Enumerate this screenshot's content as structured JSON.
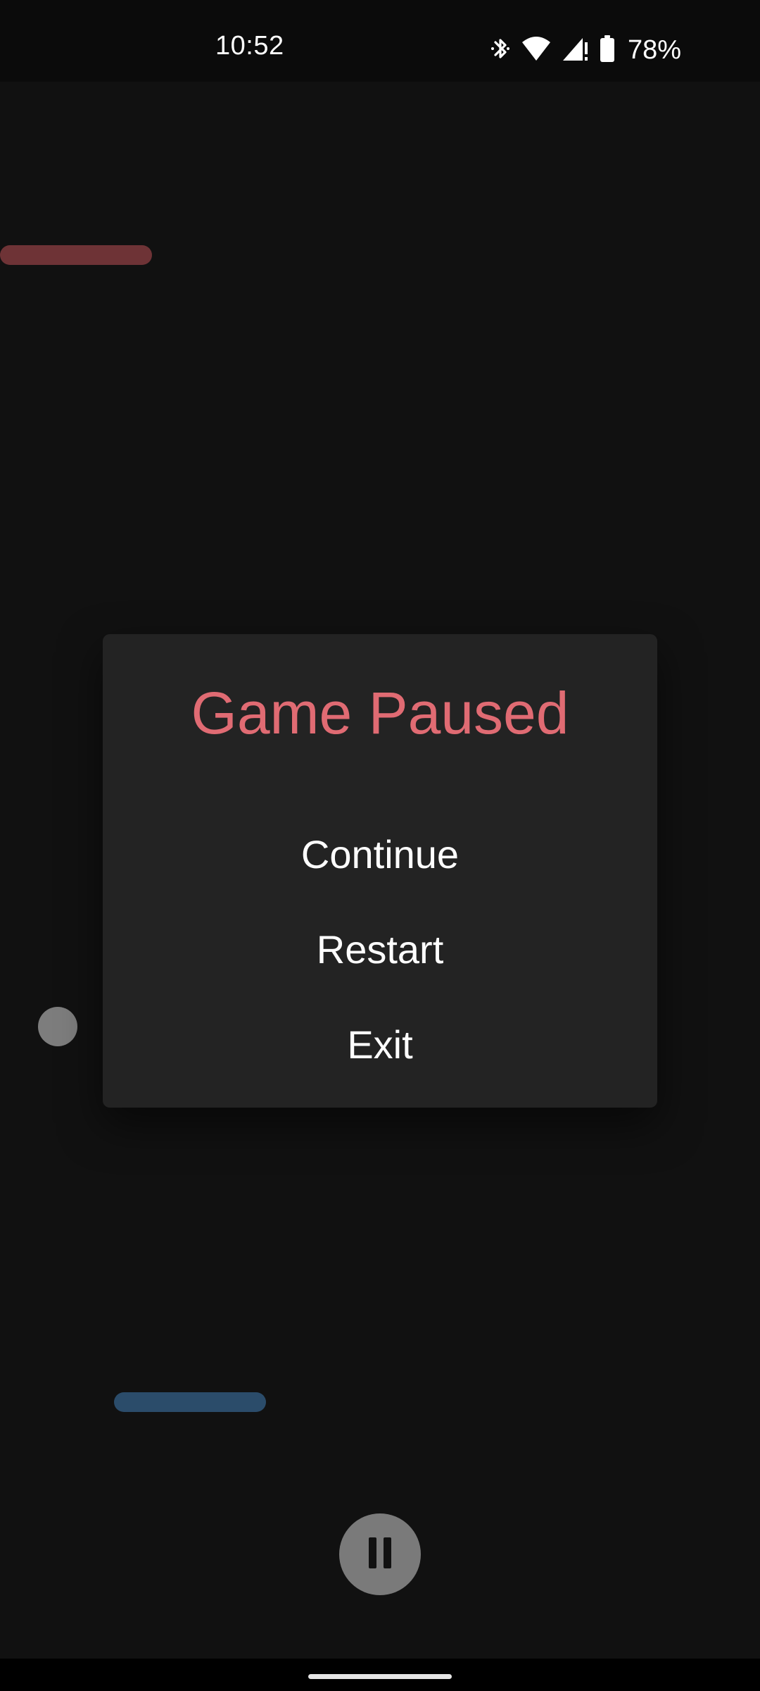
{
  "status_bar": {
    "time": "10:52",
    "battery_percent": "78%",
    "icons": [
      "bluetooth-icon",
      "wifi-icon",
      "cell-signal-icon",
      "battery-icon"
    ]
  },
  "game": {
    "paddle_top_color": "#6e3336",
    "paddle_bottom_color": "#2b4c6a",
    "ball_color": "#7d7d7d"
  },
  "pause_menu": {
    "title": "Game Paused",
    "title_color": "#e06b73",
    "buttons": {
      "continue": "Continue",
      "restart": "Restart",
      "exit": "Exit"
    }
  },
  "pause_button": {
    "icon": "pause-icon"
  }
}
